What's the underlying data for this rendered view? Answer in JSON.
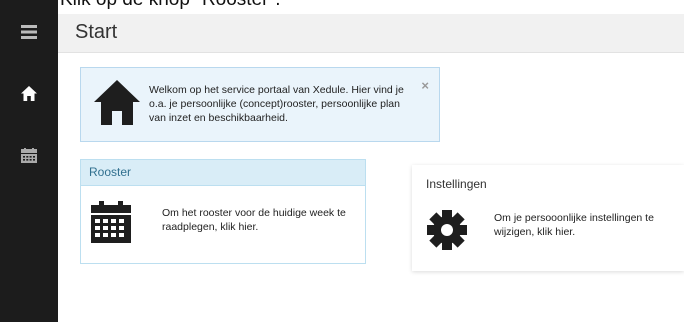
{
  "caption": "Klik op de knop \"Rooster\".",
  "header": {
    "title": "Start"
  },
  "sidebar": {
    "items": [
      {
        "icon": "menu-icon"
      },
      {
        "icon": "home-icon"
      },
      {
        "icon": "calendar-icon"
      }
    ]
  },
  "welcome": {
    "icon": "home-icon",
    "text": "Welkom op het service portaal van Xedule. Hier vind je o.a. je persoonlijke (concept)rooster, persoonlijke plan van inzet en beschikbaarheid.",
    "close": "×"
  },
  "rooster": {
    "title": "Rooster",
    "icon": "calendar-icon",
    "text": "Om het rooster voor de huidige week te raadplegen, klik hier."
  },
  "instellingen": {
    "title": "Instellingen",
    "icon": "gear-icon",
    "text": "Om je persooonlijke instellingen te wijzigen, klik hier."
  },
  "colors": {
    "sidebar": "#1c1c1c",
    "card_header": "#d9edf7",
    "card_header_text": "#31708f",
    "alert_bg": "#eaf4fb"
  }
}
